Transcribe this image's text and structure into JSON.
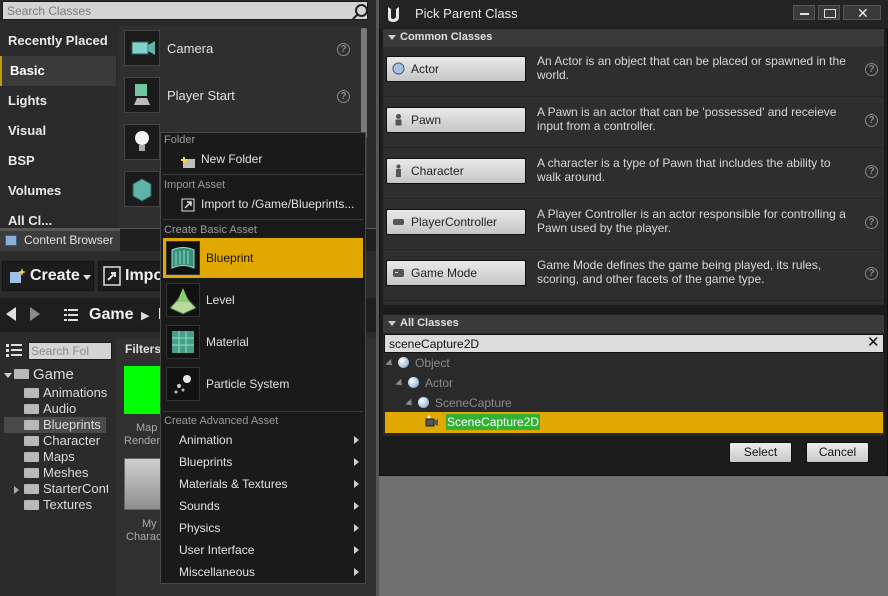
{
  "place_actors": {
    "search_placeholder": "Search Classes",
    "categories": [
      "Recently Placed",
      "Basic",
      "Lights",
      "Visual",
      "BSP",
      "Volumes",
      "All Cl..."
    ],
    "actors": [
      {
        "label": "Camera",
        "icon": "camera-icon"
      },
      {
        "label": "Player Start",
        "icon": "player-start-icon"
      },
      {
        "label": "",
        "icon": "light-bulb-icon"
      },
      {
        "label": "",
        "icon": "cube-icon"
      }
    ]
  },
  "content_browser": {
    "tab_label": "Content Browser",
    "create_label": "Create",
    "import_label": "Impo",
    "path_root": "Game",
    "path_sep": "▶",
    "path_next": "I",
    "search_folders_placeholder": "Search Fol",
    "filters_label": "Filters",
    "tree": {
      "root": "Game",
      "folders": [
        "Animations",
        "Audio",
        "Blueprints",
        "Character",
        "Maps",
        "Meshes",
        "StarterCont",
        "Textures"
      ]
    },
    "assets": [
      {
        "label": "Map",
        "sub": "Render"
      },
      {
        "label": "My",
        "sub": "Charac"
      }
    ]
  },
  "context_menu": {
    "folder_head": "Folder",
    "new_folder": "New Folder",
    "import_head": "Import Asset",
    "import_item": "Import to /Game/Blueprints...",
    "basic_head": "Create Basic Asset",
    "basic_items": [
      "Blueprint",
      "Level",
      "Material",
      "Particle System"
    ],
    "advanced_head": "Create Advanced Asset",
    "advanced_items": [
      "Animation",
      "Blueprints",
      "Materials & Textures",
      "Sounds",
      "Physics",
      "User Interface",
      "Miscellaneous"
    ]
  },
  "dialog": {
    "title": "Pick Parent Class",
    "common_head": "Common Classes",
    "classes": [
      {
        "name": "Actor",
        "desc": "An Actor is an object that can be placed or spawned in the world."
      },
      {
        "name": "Pawn",
        "desc": "A Pawn is an actor that can be 'possessed' and receieve input from a controller."
      },
      {
        "name": "Character",
        "desc": "A character is a type of Pawn that includes the ability to walk around."
      },
      {
        "name": "PlayerController",
        "desc": "A Player Controller is an actor responsible for controlling a Pawn used by the player."
      },
      {
        "name": "Game Mode",
        "desc": "Game Mode defines the game being played, its rules, scoring, and other facets of the game type."
      }
    ],
    "all_head": "All Classes",
    "filter_value": "sceneCapture2D",
    "tree": [
      "Object",
      "Actor",
      "SceneCapture",
      "SceneCapture2D"
    ],
    "select_label": "Select",
    "cancel_label": "Cancel"
  },
  "colors": {
    "accent": "#e0a800",
    "selection_highlight": "#31b031"
  }
}
